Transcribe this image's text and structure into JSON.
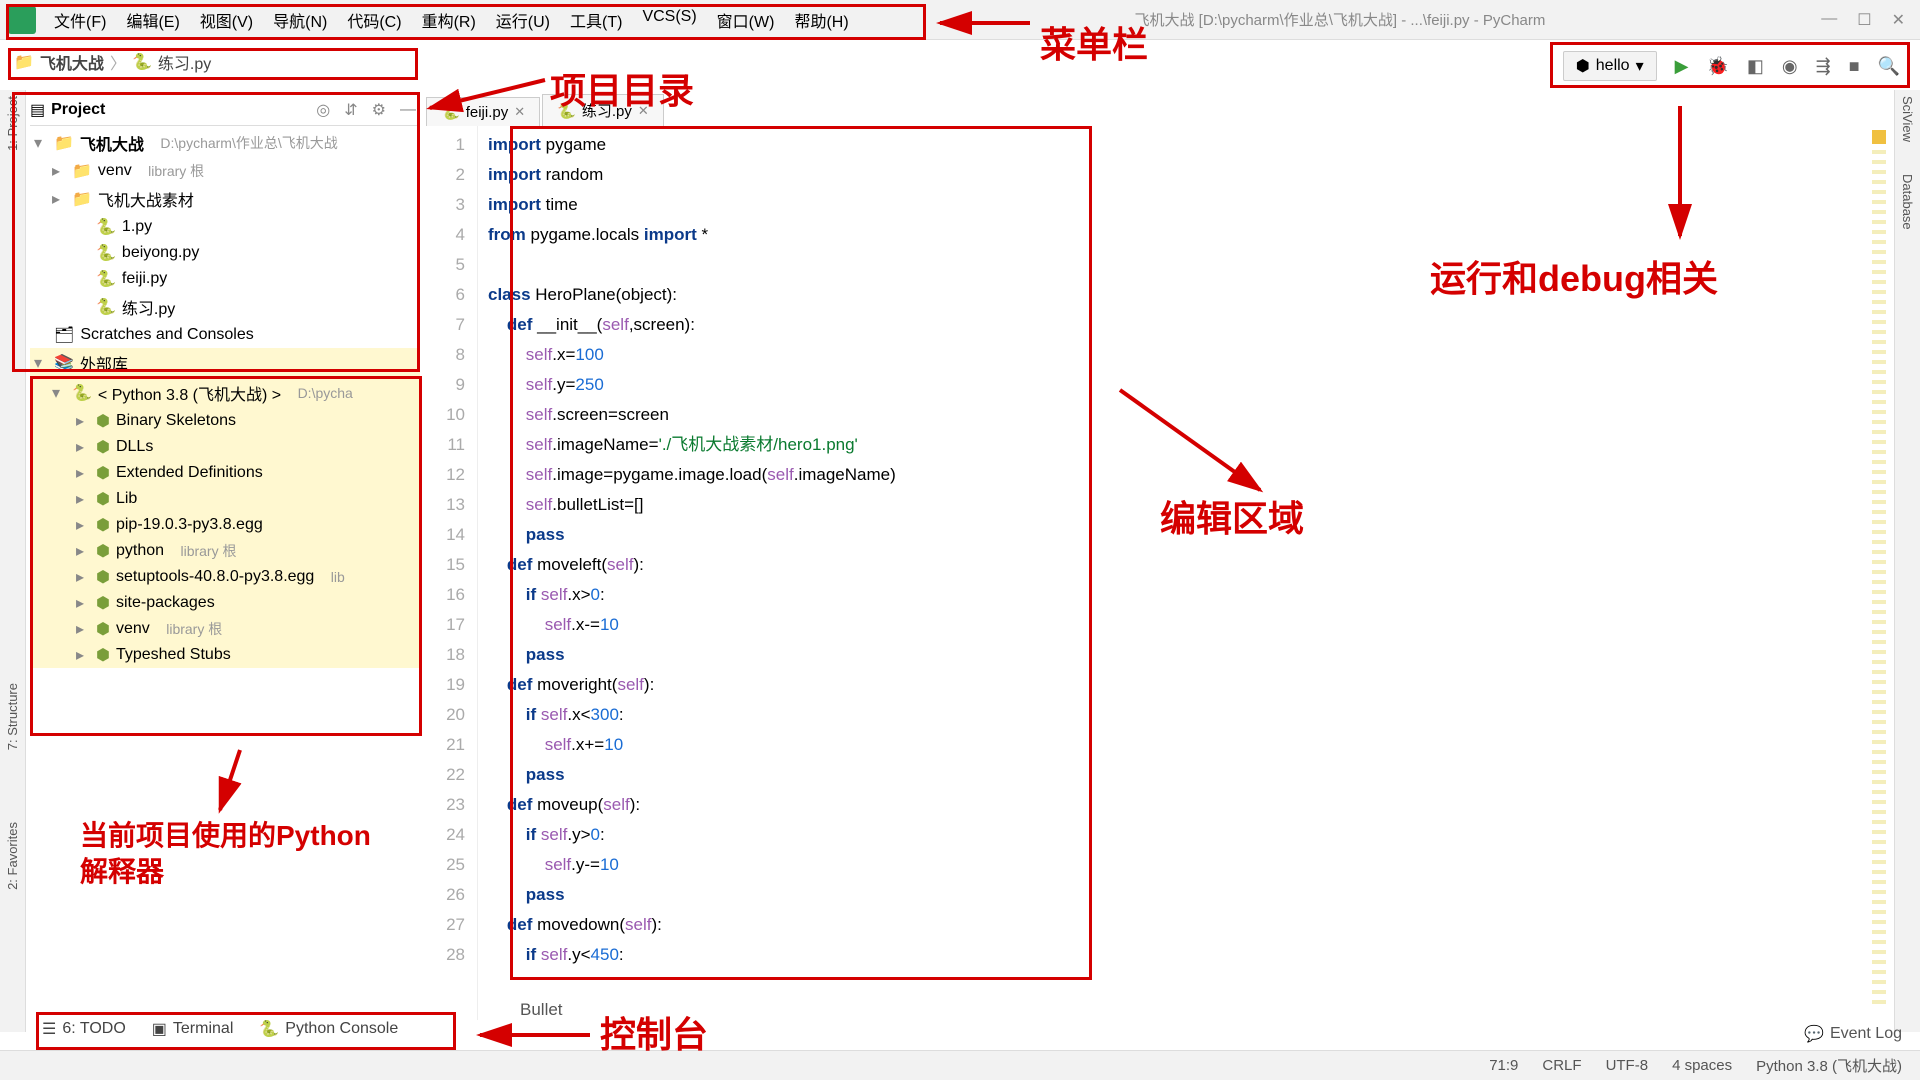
{
  "menu": {
    "items": [
      "文件(F)",
      "编辑(E)",
      "视图(V)",
      "导航(N)",
      "代码(C)",
      "重构(R)",
      "运行(U)",
      "工具(T)",
      "VCS(S)",
      "窗口(W)",
      "帮助(H)"
    ],
    "title_tail": "飞机大战 [D:\\pycharm\\作业总\\飞机大战] - ...\\feiji.py - PyCharm"
  },
  "breadcrumb": {
    "root": "飞机大战",
    "file": "练习.py"
  },
  "run": {
    "config": "hello"
  },
  "project": {
    "title": "Project",
    "root_name": "飞机大战",
    "root_path": "D:\\pycharm\\作业总\\飞机大战",
    "venv": "venv",
    "venv_hint": "library 根",
    "folder2": "飞机大战素材",
    "files": [
      "1.py",
      "beiyong.py",
      "feiji.py",
      "练习.py"
    ],
    "scratches": "Scratches and Consoles",
    "ext_lib": "外部库",
    "python": "< Python 3.8 (飞机大战) >",
    "python_path": "D:\\pycha",
    "libs": [
      "Binary Skeletons",
      "DLLs",
      "Extended Definitions",
      "Lib",
      "pip-19.0.3-py3.8.egg",
      "python",
      "setuptools-40.8.0-py3.8.egg",
      "site-packages",
      "venv",
      "Typeshed Stubs"
    ],
    "libs_hint": {
      "5": "library 根",
      "6": "lib",
      "8": "library 根"
    }
  },
  "tabs": [
    {
      "label": "feiji.py"
    },
    {
      "label": "练习.py"
    }
  ],
  "editor": {
    "lines": [
      {
        "n": 1,
        "html": "<span class='k'>import</span> pygame"
      },
      {
        "n": 2,
        "html": "<span class='k'>import</span> random"
      },
      {
        "n": 3,
        "html": "<span class='k'>import</span> time"
      },
      {
        "n": 4,
        "html": "<span class='k'>from</span> pygame.locals <span class='k'>import</span> *"
      },
      {
        "n": 5,
        "html": ""
      },
      {
        "n": 6,
        "html": "<span class='k'>class</span> HeroPlane(object):"
      },
      {
        "n": 7,
        "html": "    <span class='k'>def</span> __init__(<span class='m'>self</span>,screen):"
      },
      {
        "n": 8,
        "html": "        <span class='m'>self</span>.x=<span class='n'>100</span>"
      },
      {
        "n": 9,
        "html": "        <span class='m'>self</span>.y=<span class='n'>250</span>"
      },
      {
        "n": 10,
        "html": "        <span class='m'>self</span>.screen=screen"
      },
      {
        "n": 11,
        "html": "        <span class='m'>self</span>.imageName=<span class='s'>'./飞机大战素材/hero1.png'</span>"
      },
      {
        "n": 12,
        "html": "        <span class='m'>self</span>.image=pygame.image.load(<span class='m'>self</span>.imageName)"
      },
      {
        "n": 13,
        "html": "        <span class='m'>self</span>.bulletList=[]"
      },
      {
        "n": 14,
        "html": "        <span class='k'>pass</span>"
      },
      {
        "n": 15,
        "html": "    <span class='k'>def</span> moveleft(<span class='m'>self</span>):"
      },
      {
        "n": 16,
        "html": "        <span class='k'>if</span> <span class='m'>self</span>.x&gt;<span class='n'>0</span>:"
      },
      {
        "n": 17,
        "html": "            <span class='m'>self</span>.x-=<span class='n'>10</span>"
      },
      {
        "n": 18,
        "html": "        <span class='k'>pass</span>"
      },
      {
        "n": 19,
        "html": "    <span class='k'>def</span> moveright(<span class='m'>self</span>):"
      },
      {
        "n": 20,
        "html": "        <span class='k'>if</span> <span class='m'>self</span>.x&lt;<span class='n'>300</span>:"
      },
      {
        "n": 21,
        "html": "            <span class='m'>self</span>.x+=<span class='n'>10</span>"
      },
      {
        "n": 22,
        "html": "        <span class='k'>pass</span>"
      },
      {
        "n": 23,
        "html": "    <span class='k'>def</span> moveup(<span class='m'>self</span>):"
      },
      {
        "n": 24,
        "html": "        <span class='k'>if</span> <span class='m'>self</span>.y&gt;<span class='n'>0</span>:"
      },
      {
        "n": 25,
        "html": "            <span class='m'>self</span>.y-=<span class='n'>10</span>"
      },
      {
        "n": 26,
        "html": "        <span class='k'>pass</span>"
      },
      {
        "n": 27,
        "html": "    <span class='k'>def</span> movedown(<span class='m'>self</span>):"
      },
      {
        "n": 28,
        "html": "        <span class='k'>if</span> <span class='m'>self</span>.y&lt;<span class='n'>450</span>:"
      }
    ],
    "crumb_path": "Bullet"
  },
  "bottom": {
    "todo": "6: TODO",
    "terminal": "Terminal",
    "console": "Python Console",
    "event_log": "Event Log"
  },
  "status": {
    "pos": "71:9",
    "eol": "CRLF",
    "enc": "UTF-8",
    "indent": "4 spaces",
    "interp": "Python 3.8 (飞机大战)"
  },
  "right_tools": [
    "SciView",
    "Database"
  ],
  "left_tools": [
    "1: Project",
    "7: Structure",
    "2: Favorites"
  ],
  "annotations": {
    "menu": "菜单栏",
    "proj_dir": "项目目录",
    "run_debug": "运行和debug相关",
    "edit_area": "编辑区域",
    "interpreter": "当前项目使用的Python解释器",
    "console": "控制台"
  }
}
